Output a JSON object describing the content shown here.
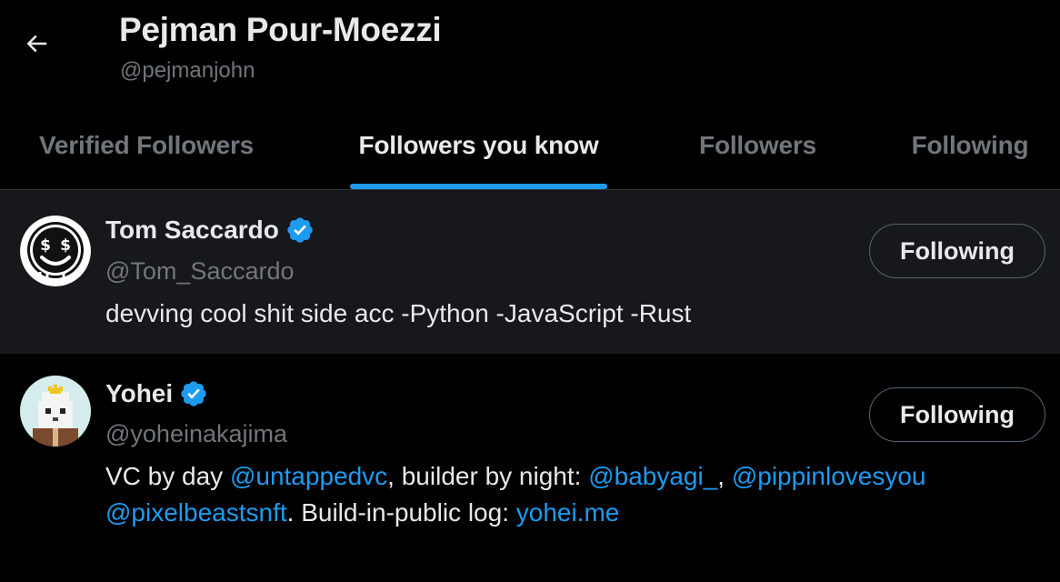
{
  "header": {
    "name": "Pejman Pour-Moezzi",
    "handle": "@pejmanjohn"
  },
  "tabs": [
    {
      "label": "Verified Followers",
      "active": false
    },
    {
      "label": "Followers you know",
      "active": true
    },
    {
      "label": "Followers",
      "active": false
    },
    {
      "label": "Following",
      "active": false
    }
  ],
  "users": [
    {
      "display_name": "Tom Saccardo",
      "handle": "@Tom_Saccardo",
      "verified": true,
      "button_label": "Following",
      "bio": "devving cool shit side acc -Python -JavaScript -Rust"
    },
    {
      "display_name": "Yohei",
      "handle": "@yoheinakajima",
      "verified": true,
      "button_label": "Following",
      "bio_parts": {
        "p1": "VC by day ",
        "l1": "@untappedvc",
        "p2": ", builder by night: ",
        "l2": "@babyagi_",
        "p3": ", ",
        "l3": "@pippinlovesyou",
        "l4": "@pixelbeastsnft",
        "p4": ". Build-in-public log: ",
        "l5": "yohei.me"
      }
    }
  ],
  "colors": {
    "accent": "#1d9bf0",
    "background": "#000000",
    "row_highlight": "#16181c",
    "text_primary": "#e7e9ea",
    "text_secondary": "#71767b"
  },
  "icons": {
    "back": "arrow-left-icon",
    "verified": "verified-badge-icon"
  }
}
